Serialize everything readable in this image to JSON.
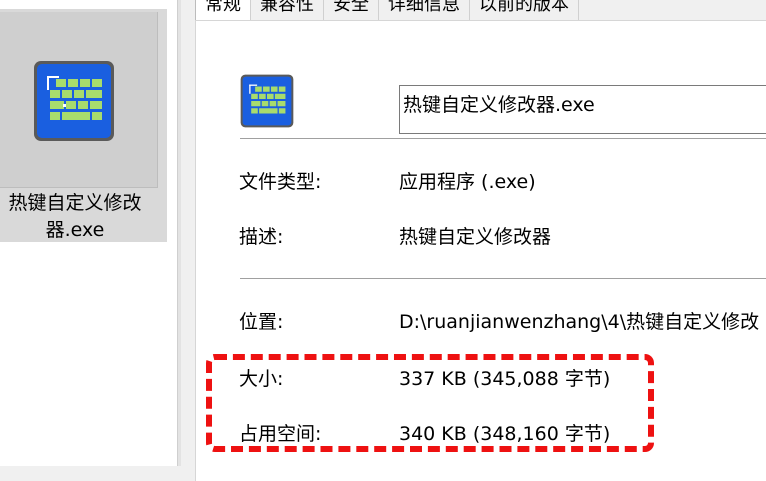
{
  "explorer": {
    "file_name": "热键自定义修改器.exe",
    "icon": "keyboard-icon"
  },
  "tabs": [
    {
      "label": "常规",
      "active": true
    },
    {
      "label": "兼容性",
      "active": false
    },
    {
      "label": "安全",
      "active": false
    },
    {
      "label": "详细信息",
      "active": false
    },
    {
      "label": "以前的版本",
      "active": false
    }
  ],
  "general": {
    "file_name_value": "热键自定义修改器.exe",
    "file_type_label": "文件类型:",
    "file_type_value": "应用程序 (.exe)",
    "description_label": "描述:",
    "description_value": "热键自定义修改器",
    "location_label": "位置:",
    "location_value": "D:\\ruanjianwenzhang\\4\\热键自定义修改",
    "size_label": "大小:",
    "size_value": "337 KB (345,088 字节)",
    "disk_size_label": "占用空间:",
    "disk_size_value": "340 KB (348,160 字节)"
  },
  "colors": {
    "icon_blue": "#1a5fe0",
    "icon_green": "#9ad65a",
    "highlight_red": "#ee1111"
  }
}
